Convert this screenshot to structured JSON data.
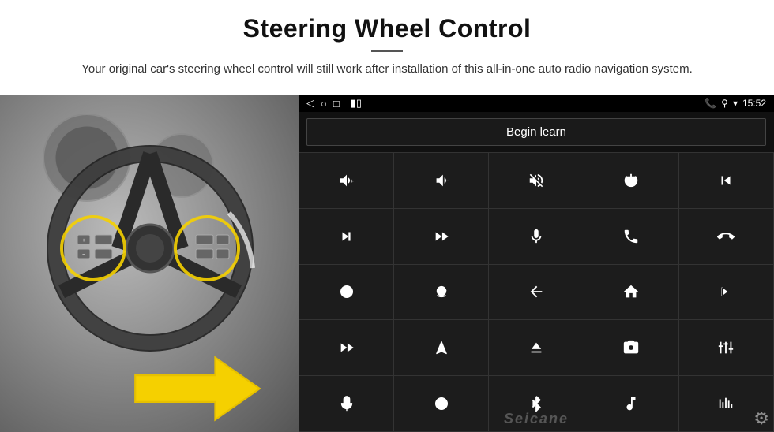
{
  "header": {
    "title": "Steering Wheel Control",
    "subtitle": "Your original car's steering wheel control will still work after installation of this all-in-one auto radio navigation system."
  },
  "status_bar": {
    "left_icons": [
      "◁",
      "○",
      "□"
    ],
    "right_icons": [
      "📞",
      "⚲",
      "▾"
    ],
    "time": "15:52"
  },
  "begin_learn_label": "Begin learn",
  "watermark": "Seicane",
  "grid_icons": [
    {
      "id": "vol-up",
      "symbol": "🔊+"
    },
    {
      "id": "vol-down",
      "symbol": "🔉−"
    },
    {
      "id": "mute",
      "symbol": "🔇×"
    },
    {
      "id": "power",
      "symbol": "⏻"
    },
    {
      "id": "prev-track-call",
      "symbol": "⏮"
    },
    {
      "id": "next-track",
      "symbol": "⏭"
    },
    {
      "id": "fast-fwd-mic",
      "symbol": "⏩"
    },
    {
      "id": "mic",
      "symbol": "🎤"
    },
    {
      "id": "phone",
      "symbol": "📞"
    },
    {
      "id": "hang-up",
      "symbol": "↩"
    },
    {
      "id": "speaker",
      "symbol": "🔈"
    },
    {
      "id": "360",
      "symbol": "360°"
    },
    {
      "id": "back",
      "symbol": "↩"
    },
    {
      "id": "home",
      "symbol": "⌂"
    },
    {
      "id": "skip-back",
      "symbol": "⏮"
    },
    {
      "id": "fast-forward",
      "symbol": "⏭"
    },
    {
      "id": "nav",
      "symbol": "➤"
    },
    {
      "id": "eject",
      "symbol": "⏏"
    },
    {
      "id": "camera",
      "symbol": "📷"
    },
    {
      "id": "equalizer",
      "symbol": "🎛"
    },
    {
      "id": "mic2",
      "symbol": "🎤"
    },
    {
      "id": "settings2",
      "symbol": "⚙"
    },
    {
      "id": "bluetooth",
      "symbol": "✦"
    },
    {
      "id": "music",
      "symbol": "🎵"
    },
    {
      "id": "levels",
      "symbol": "|||"
    }
  ]
}
